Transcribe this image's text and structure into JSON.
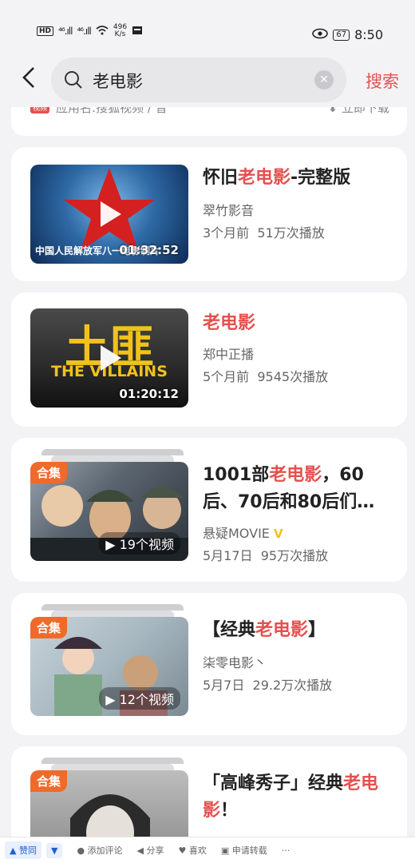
{
  "status_bar": {
    "hd": "HD",
    "signal1": "⁴⁶.ıll",
    "signal2": "⁴⁶.ıll",
    "speed_value": "496",
    "speed_unit": "K/s",
    "battery": "67",
    "time": "8:50"
  },
  "search": {
    "query": "老电影",
    "button": "搜索"
  },
  "previous_card": {
    "tag": "视频",
    "text": "应用名:搜狐视频 / 音",
    "download": "立即下载"
  },
  "results": [
    {
      "title_pre": "怀旧",
      "title_hl": "老电影",
      "title_post": "-完整版",
      "author": "翠竹影音",
      "time": "3个月前",
      "plays": "51万次播放",
      "duration": "01:32:52",
      "thumb_caption": "中国人民解放军八一电影制片"
    },
    {
      "title_pre": "",
      "title_hl": "老电影",
      "title_post": "",
      "author": "郑中正播",
      "time": "5个月前",
      "plays": "9545次播放",
      "duration": "01:20:12",
      "thumb_big": "土匪",
      "thumb_sub": "THE VILLAINS"
    },
    {
      "badge": "合集",
      "title_pre": "1001部",
      "title_hl": "老电影",
      "title_post": "，60后、70后和80后们…",
      "author": "悬疑MOVIE",
      "verified": "V",
      "time": "5月17日",
      "plays": "95万次播放",
      "count": "▶ 19个视频"
    },
    {
      "badge": "合集",
      "title_pre": "【经典",
      "title_hl": "老电影",
      "title_post": "】",
      "author": "柒零电影丶",
      "time": "5月7日",
      "plays": "29.2万次播放",
      "count": "▶ 12个视频"
    },
    {
      "badge": "合集",
      "title_pre": "「高峰秀子」经典",
      "title_hl": "老电影",
      "title_post": "！"
    }
  ],
  "bottom_bar": {
    "like": "▲ 赞同",
    "down": "▼",
    "comment": "● 添加评论",
    "share": "◀ 分享",
    "fav": "♥ 喜欢",
    "repost": "▣ 申请转载",
    "more": "···"
  }
}
